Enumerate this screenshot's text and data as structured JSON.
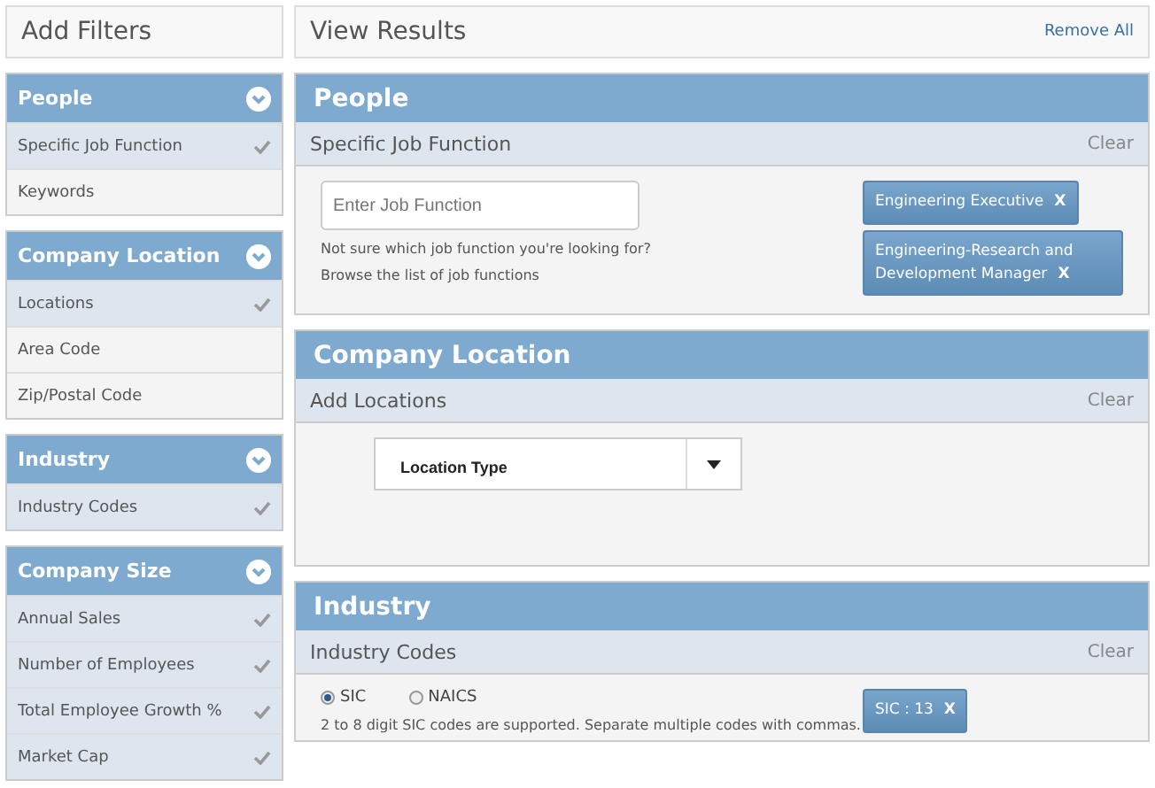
{
  "filters": {
    "title": "Add Filters",
    "groups": [
      {
        "title": "People",
        "items": [
          {
            "label": "Specific Job Function",
            "checked": true
          },
          {
            "label": "Keywords",
            "checked": false
          }
        ]
      },
      {
        "title": "Company Location",
        "items": [
          {
            "label": "Locations",
            "checked": true
          },
          {
            "label": "Area Code",
            "checked": false
          },
          {
            "label": "Zip/Postal Code",
            "checked": false
          }
        ]
      },
      {
        "title": "Industry",
        "items": [
          {
            "label": "Industry Codes",
            "checked": true
          }
        ]
      },
      {
        "title": "Company Size",
        "items": [
          {
            "label": "Annual Sales",
            "checked": true
          },
          {
            "label": "Number of Employees",
            "checked": true
          },
          {
            "label": "Total Employee Growth %",
            "checked": true
          },
          {
            "label": "Market Cap",
            "checked": true
          }
        ]
      }
    ]
  },
  "results": {
    "title": "View Results",
    "remove_all": "Remove All",
    "sections": [
      {
        "kind": "job_function",
        "title": "People",
        "subtitle": "Specific Job Function",
        "clear": "Clear",
        "placeholder": "Enter Job Function",
        "hint": "Not sure which job function you're looking for?",
        "link": "Browse the list of job functions",
        "tags": [
          {
            "label": "Engineering Executive",
            "remove": "X"
          },
          {
            "label": "Engineering-Research and Development Manager",
            "remove": "X"
          }
        ]
      },
      {
        "kind": "location",
        "title": "Company Location",
        "subtitle": "Add Locations",
        "clear": "Clear",
        "dropdown": "Location Type"
      },
      {
        "kind": "industry",
        "title": "Industry",
        "subtitle": "Industry Codes",
        "clear": "Clear",
        "radios": [
          {
            "label": "SIC",
            "selected": true
          },
          {
            "label": "NAICS",
            "selected": false
          }
        ],
        "hint": "2 to 8 digit SIC codes are supported. Separate multiple codes with commas.",
        "tags": [
          {
            "label": "SIC : 13",
            "remove": "X"
          }
        ]
      }
    ]
  }
}
